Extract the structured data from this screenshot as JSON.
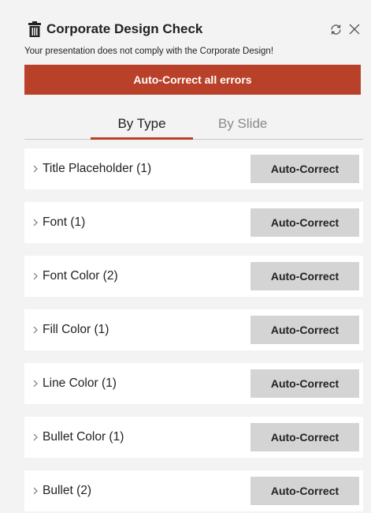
{
  "header": {
    "title": "Corporate Design Check",
    "subtitle": "Your presentation does not comply with the Corporate Design!",
    "icons": [
      "trash-icon",
      "refresh-icon",
      "close-icon"
    ]
  },
  "autocorrect_all_label": "Auto-Correct all errors",
  "accent_color": "#b9412a",
  "tabs": [
    {
      "label": "By Type",
      "active": true
    },
    {
      "label": "By Slide",
      "active": false
    }
  ],
  "rows": [
    {
      "label": "Title Placeholder (1)",
      "button": "Auto-Correct"
    },
    {
      "label": "Font (1)",
      "button": "Auto-Correct"
    },
    {
      "label": "Font Color (2)",
      "button": "Auto-Correct"
    },
    {
      "label": "Fill Color (1)",
      "button": "Auto-Correct"
    },
    {
      "label": "Line Color (1)",
      "button": "Auto-Correct"
    },
    {
      "label": "Bullet Color (1)",
      "button": "Auto-Correct"
    },
    {
      "label": "Bullet (2)",
      "button": "Auto-Correct"
    }
  ]
}
